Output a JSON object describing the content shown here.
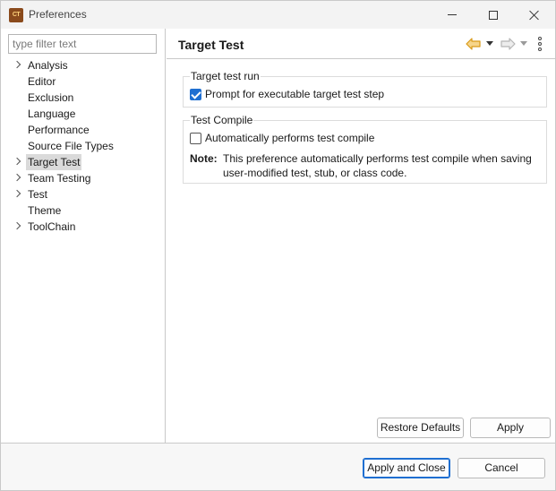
{
  "window": {
    "app_icon_text": "CT",
    "title": "Preferences"
  },
  "filter": {
    "placeholder": "type filter text",
    "value": ""
  },
  "tree": {
    "items": [
      {
        "label": "Analysis",
        "expandable": true,
        "selected": false
      },
      {
        "label": "Editor",
        "expandable": false,
        "selected": false
      },
      {
        "label": "Exclusion",
        "expandable": false,
        "selected": false
      },
      {
        "label": "Language",
        "expandable": false,
        "selected": false
      },
      {
        "label": "Performance",
        "expandable": false,
        "selected": false
      },
      {
        "label": "Source File Types",
        "expandable": false,
        "selected": false
      },
      {
        "label": "Target Test",
        "expandable": true,
        "selected": true
      },
      {
        "label": "Team Testing",
        "expandable": true,
        "selected": false
      },
      {
        "label": "Test",
        "expandable": true,
        "selected": false
      },
      {
        "label": "Theme",
        "expandable": false,
        "selected": false
      },
      {
        "label": "ToolChain",
        "expandable": true,
        "selected": false
      }
    ]
  },
  "page": {
    "title": "Target Test",
    "icons": {
      "back": "arrow-left-icon",
      "forward": "arrow-right-icon",
      "menu": "kebab-menu-icon"
    },
    "colors": {
      "back_arrow": "#e0a020",
      "forward_arrow": "#b5b5b5",
      "checkbox_checked": "#1f6fd1"
    }
  },
  "target_test_run": {
    "legend": "Target test run",
    "prompt_label": "Prompt for executable target test step",
    "prompt_checked": true
  },
  "test_compile": {
    "legend": "Test Compile",
    "auto_label": "Automatically performs test compile",
    "auto_checked": false,
    "note_label": "Note:",
    "note_text": "This preference automatically performs test compile when saving user-modified test, stub, or class code."
  },
  "buttons": {
    "restore_defaults": "Restore Defaults",
    "apply": "Apply",
    "apply_and_close": "Apply and Close",
    "cancel": "Cancel"
  }
}
